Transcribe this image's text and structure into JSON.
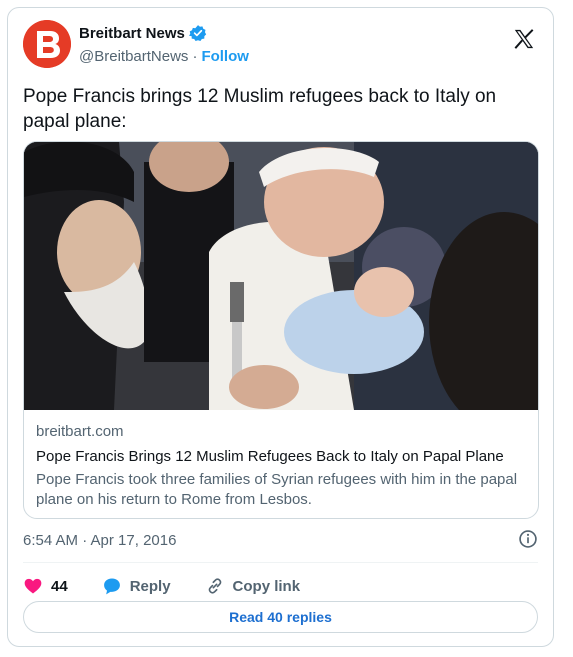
{
  "account": {
    "name": "Breitbart News",
    "handle": "@BreitbartNews",
    "separator": "·",
    "follow_label": "Follow",
    "verified": true,
    "avatar_letter": "B",
    "avatar_color": "#e53b26"
  },
  "tweet": {
    "text": "Pope Francis brings 12 Muslim refugees back to Italy on papal plane:",
    "timestamp": "6:54 AM · Apr 17, 2016"
  },
  "link_card": {
    "domain": "breitbart.com",
    "title": "Pope Francis Brings 12 Muslim Refugees Back to Italy on Papal Plane",
    "description": "Pope Francis took three families of Syrian refugees with him in the papal plane on his return to Rome from Lesbos."
  },
  "actions": {
    "like_count": "44",
    "reply_label": "Reply",
    "copy_link_label": "Copy link",
    "read_replies_label": "Read 40 replies"
  },
  "colors": {
    "accent": "#1d9bf0",
    "like": "#f91880",
    "reply_link": "#1d6fd0",
    "muted": "#536471"
  },
  "icons": [
    "verified-badge-icon",
    "x-logo-icon",
    "info-icon",
    "heart-icon",
    "reply-bubble-icon",
    "link-icon"
  ]
}
